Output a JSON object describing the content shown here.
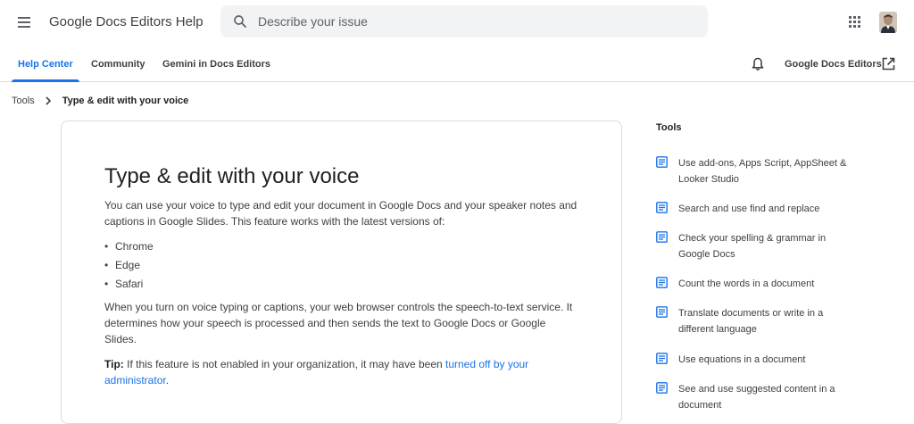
{
  "header": {
    "app_title": "Google Docs Editors Help",
    "search_placeholder": "Describe your issue"
  },
  "nav": {
    "tabs": [
      {
        "label": "Help Center",
        "active": true
      },
      {
        "label": "Community",
        "active": false
      },
      {
        "label": "Gemini in Docs Editors",
        "active": false
      }
    ],
    "product_link": "Google Docs Editors"
  },
  "breadcrumb": {
    "parent": "Tools",
    "current": "Type & edit with your voice"
  },
  "article": {
    "title": "Type & edit with your voice",
    "intro": "You can use your voice to type and edit your document in Google Docs and your speaker notes and captions in Google Slides. This feature works with the latest versions of:",
    "browsers": [
      "Chrome",
      "Edge",
      "Safari"
    ],
    "bullet": "•",
    "service_note": "When you turn on voice typing or captions, your web browser controls the speech-to-text service. It determines how your speech is processed and then sends the text to Google Docs or Google Slides.",
    "tip": {
      "label": "Tip:",
      "text": " If this feature is not enabled in your organization, it may have been ",
      "link_text": "turned off by your administrator",
      "end": "."
    }
  },
  "sidebar": {
    "title": "Tools",
    "items": [
      {
        "label": "Use add-ons, Apps Script, AppSheet & Looker Studio"
      },
      {
        "label": "Search and use find and replace"
      },
      {
        "label": "Check your spelling & grammar in Google Docs"
      },
      {
        "label": "Count the words in a document"
      },
      {
        "label": "Translate documents or write in a different language"
      },
      {
        "label": "Use equations in a document"
      },
      {
        "label": "See and use suggested content in a document"
      }
    ]
  },
  "colors": {
    "accent": "#1a73e8",
    "text": "#3c4043",
    "border": "#dadce0",
    "search_bg": "#f1f3f4"
  },
  "icons": {
    "menu": "hamburger-menu-icon",
    "search": "magnifier-icon",
    "apps": "grid-apps-icon",
    "notifications": "bell-icon",
    "external": "open-in-new-icon",
    "breadcrumb_separator": "chevron-right-icon",
    "article": "article-doc-icon"
  }
}
